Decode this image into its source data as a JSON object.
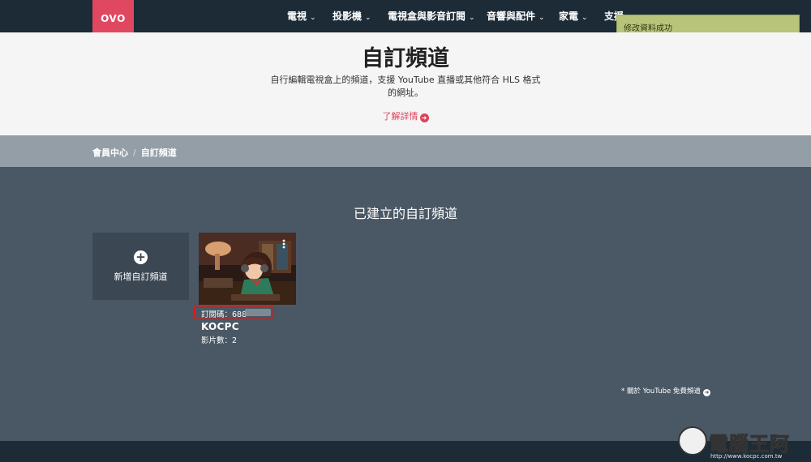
{
  "brand": {
    "logo_text": "OVO",
    "color": "#e04761"
  },
  "nav": {
    "items": [
      {
        "label": "電視"
      },
      {
        "label": "投影機"
      },
      {
        "label": "電視盒與影音訂閱"
      },
      {
        "label": "音響與配件"
      },
      {
        "label": "家電"
      },
      {
        "label": "支援"
      }
    ]
  },
  "toast": {
    "message": "修改資料成功"
  },
  "hero": {
    "title": "自訂頻道",
    "desc_line1": "自行編輯電視盒上的頻道，支援 YouTube 直播或其他符合 HLS 格式",
    "desc_line2": "的網址。",
    "link_label": "了解詳情"
  },
  "breadcrumb": {
    "home": "會員中心",
    "separator": "/",
    "current": "自訂頻道"
  },
  "main": {
    "section_title": "已建立的自訂頻道",
    "add_card_label": "新增自訂頻道",
    "channels": [
      {
        "code_label": "訂閱碼：688",
        "name": "KOCPC",
        "count_label": "影片數：2"
      }
    ],
    "yt_note": "* 關於 YouTube 免費頻道"
  },
  "watermark": {
    "text": "電腦王阿達",
    "url": "http://www.kocpc.com.tw"
  }
}
